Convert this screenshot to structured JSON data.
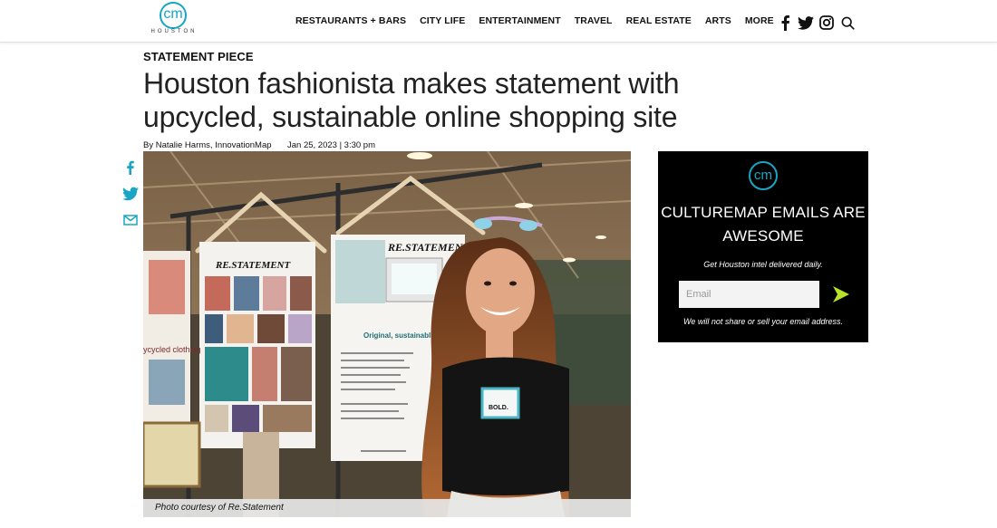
{
  "header": {
    "logo_mark": "cm",
    "logo_city": "HOUSTON",
    "nav": [
      "RESTAURANTS + BARS",
      "CITY LIFE",
      "ENTERTAINMENT",
      "TRAVEL",
      "REAL ESTATE",
      "ARTS",
      "MORE"
    ],
    "social_icons": [
      "facebook-icon",
      "twitter-icon",
      "instagram-icon",
      "search-icon"
    ]
  },
  "article": {
    "kicker": "STATEMENT PIECE",
    "headline": "Houston fashionista makes statement with upcycled, sustainable online shopping site",
    "byline": "By Natalie Harms, InnovationMap",
    "date": "Jan 25, 2023 | 3:30 pm",
    "share_icons": [
      "facebook-icon",
      "twitter-icon",
      "email-icon"
    ],
    "photo_caption": "Photo courtesy of Re.Statement",
    "photo_sign_text": {
      "left_board": "RE.STATEMENT",
      "right_board": "RE.STATEMENT",
      "right_subtitle": "Original, sustainable designs",
      "left_partial": "ycycled clothing",
      "name_tag": "BOLD."
    }
  },
  "newsletter": {
    "logo_mark": "cm",
    "title": "CULTUREMAP EMAILS ARE AWESOME",
    "subtitle": "Get Houston intel delivered daily.",
    "email_placeholder": "Email",
    "note": "We will not share or sell your email address."
  },
  "colors": {
    "brand": "#19a6c4",
    "submit_arrow": "#b7e22a",
    "newsletter_bg": "#000000"
  }
}
